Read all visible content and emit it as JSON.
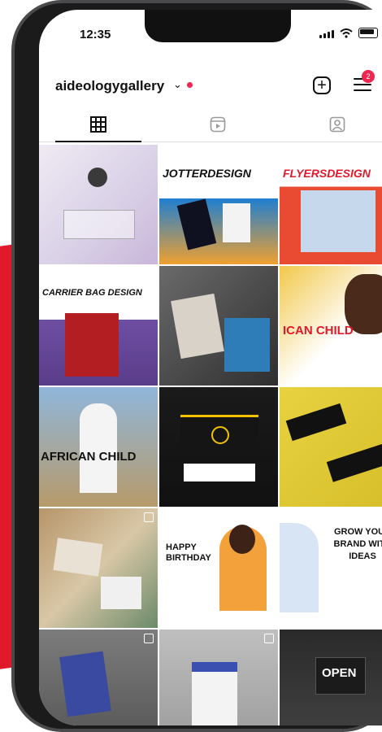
{
  "status_bar": {
    "time": "12:35"
  },
  "profile": {
    "username": "aideologygallery",
    "notification_count": "2"
  },
  "tabs": [
    {
      "name": "posts-grid",
      "active": true
    },
    {
      "name": "reels",
      "active": false
    },
    {
      "name": "tagged",
      "active": false
    }
  ],
  "posts": [
    {
      "name": "post-1",
      "text": ""
    },
    {
      "name": "post-2",
      "text": "JOTTERDESIGN"
    },
    {
      "name": "post-3",
      "text": "FLYERSDESIGN"
    },
    {
      "name": "post-4",
      "text": "CARRIER BAG DESIGN"
    },
    {
      "name": "post-5",
      "text": ""
    },
    {
      "name": "post-6",
      "text": "ICAN CHILD"
    },
    {
      "name": "post-7",
      "text": "AFRICAN CHILD"
    },
    {
      "name": "post-8",
      "text": ""
    },
    {
      "name": "post-9",
      "text": ""
    },
    {
      "name": "post-10",
      "text": ""
    },
    {
      "name": "post-11",
      "text": "HAPPY BIRTHDAY"
    },
    {
      "name": "post-12",
      "text": "GROW YOUR BRAND WITH IDEAS"
    },
    {
      "name": "post-13",
      "text": ""
    },
    {
      "name": "post-14",
      "text": ""
    },
    {
      "name": "post-15",
      "text": "OPEN"
    }
  ],
  "colors": {
    "accent": "#ef2650",
    "brand_red": "#e0192b"
  }
}
